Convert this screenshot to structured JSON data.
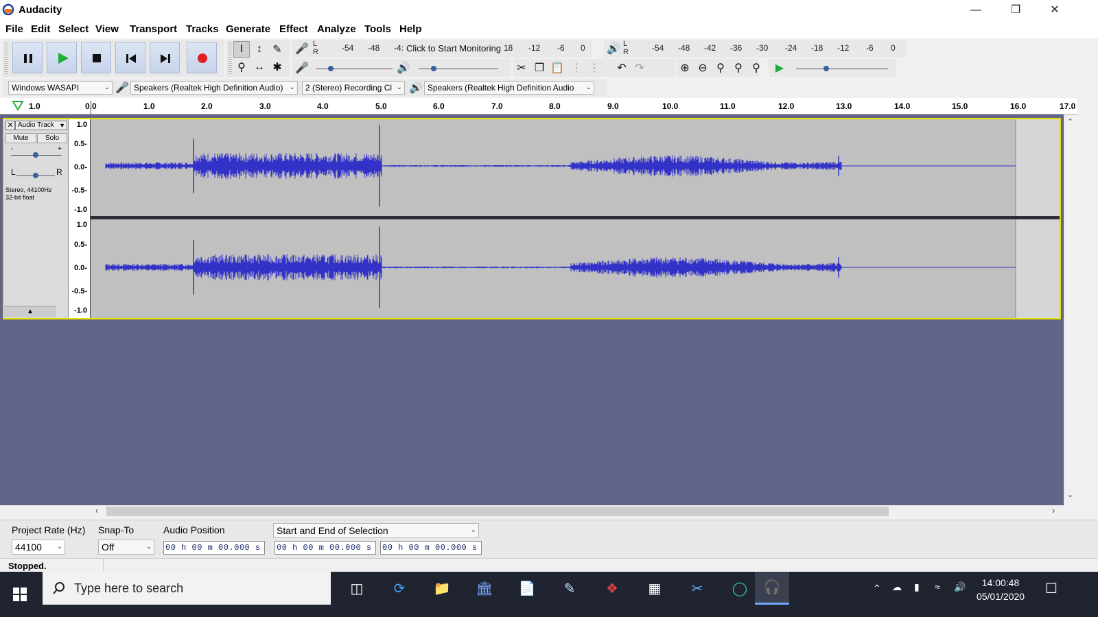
{
  "window": {
    "title": "Audacity"
  },
  "menu": [
    "File",
    "Edit",
    "Select",
    "View",
    "Transport",
    "Tracks",
    "Generate",
    "Effect",
    "Analyze",
    "Tools",
    "Help"
  ],
  "transport": {
    "pause": "pause-icon",
    "play": "play-icon",
    "stop": "stop-icon",
    "skip_start": "skip-start-icon",
    "skip_end": "skip-end-icon",
    "record": "record-icon"
  },
  "meters": {
    "record_LR": [
      "L",
      "R"
    ],
    "record_scale": [
      "-54",
      "-48",
      "-4:",
      "18",
      "-12",
      "-6",
      "0"
    ],
    "monitor_text": "Click to Start Monitoring",
    "play_LR": [
      "L",
      "R"
    ],
    "play_scale": [
      "-54",
      "-48",
      "-42",
      "-36",
      "-30",
      "-24",
      "-18",
      "-12",
      "-6",
      "0"
    ]
  },
  "device": {
    "host": "Windows WASAPI",
    "recording_device": "Speakers (Realtek High Definition Audio)",
    "channels": "2 (Stereo) Recording Cl",
    "playback_device": "Speakers (Realtek High Definition Audio"
  },
  "ruler": {
    "ticks": [
      "1.0",
      "0.0",
      "1.0",
      "2.0",
      "3.0",
      "4.0",
      "5.0",
      "6.0",
      "7.0",
      "8.0",
      "9.0",
      "10.0",
      "11.0",
      "12.0",
      "13.0",
      "14.0",
      "15.0",
      "16.0",
      "17.0"
    ]
  },
  "track": {
    "name": "Audio Track",
    "mute": "Mute",
    "solo": "Solo",
    "gain_minus": "-",
    "gain_plus": "+",
    "pan_L": "L",
    "pan_R": "R",
    "info_line1": "Stereo, 44100Hz",
    "info_line2": "32-bit float",
    "vscale": [
      "1.0",
      "0.5-",
      "0.0-",
      "-0.5-",
      "-1.0"
    ]
  },
  "selection": {
    "rate_label": "Project Rate (Hz)",
    "rate_value": "44100",
    "snap_label": "Snap-To",
    "snap_value": "Off",
    "audio_pos_label": "Audio Position",
    "audio_pos_value": "00 h 00 m 00.000 s",
    "selection_mode": "Start and End of Selection",
    "start_value": "00 h 00 m 00.000 s",
    "end_value": "00 h 00 m 00.000 s"
  },
  "status": "Stopped.",
  "taskbar": {
    "search_placeholder": "Type here to search",
    "time": "14:00:48",
    "date": "05/01/2020"
  }
}
